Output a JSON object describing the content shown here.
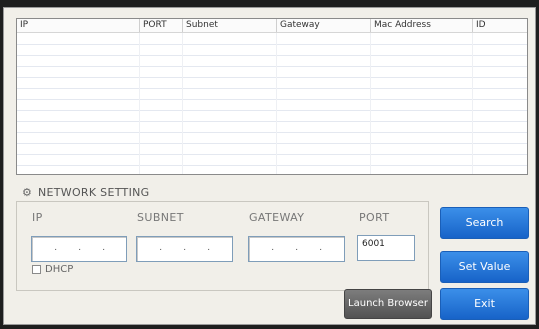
{
  "table": {
    "columns": [
      "IP",
      "PORT",
      "Subnet",
      "Gateway",
      "Mac Address",
      "ID"
    ],
    "row_count": 13
  },
  "network_setting": {
    "title": "NETWORK SETTING",
    "labels": {
      "ip": "IP",
      "subnet": "SUBNET",
      "gateway": "GATEWAY",
      "port": "PORT"
    },
    "port_value": "6001",
    "dhcp_label": "DHCP",
    "dhcp_checked": false
  },
  "buttons": {
    "search": "Search",
    "set_value": "Set Value",
    "launch_browser": "Launch Browser",
    "exit": "Exit"
  }
}
